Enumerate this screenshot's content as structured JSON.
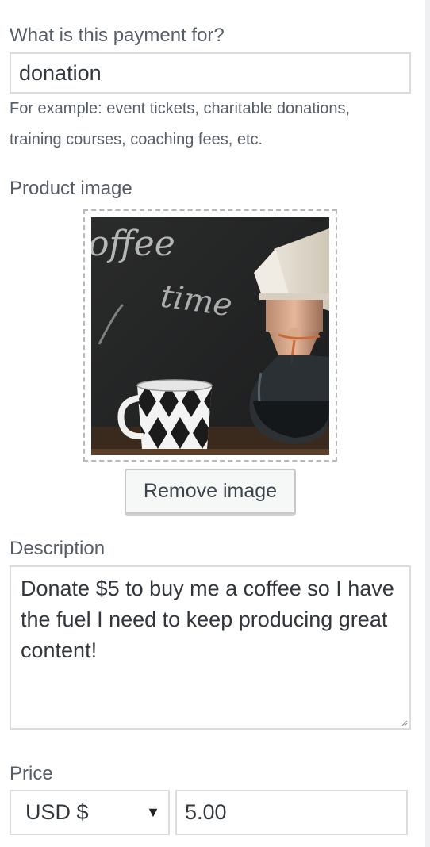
{
  "payment_for": {
    "label": "What is this payment for?",
    "value": "donation",
    "help_line1": "For example: event tickets, charitable donations,",
    "help_line2": "training courses, coaching fees, etc."
  },
  "product_image": {
    "label": "Product image",
    "remove_label": "Remove image",
    "chalk_text_1": "offee",
    "chalk_text_2": "time"
  },
  "description": {
    "label": "Description",
    "value": "Donate $5 to buy me a coffee so I have the fuel I need to keep producing great content!"
  },
  "price": {
    "label": "Price",
    "currency": "USD $",
    "amount": "5.00"
  },
  "icons": {
    "select_caret": "dropdown-caret-icon",
    "resize": "resize-grip-icon"
  },
  "colors": {
    "label_text": "#555d66",
    "input_border": "#dcdcde",
    "button_bg": "#f6f7f7"
  }
}
